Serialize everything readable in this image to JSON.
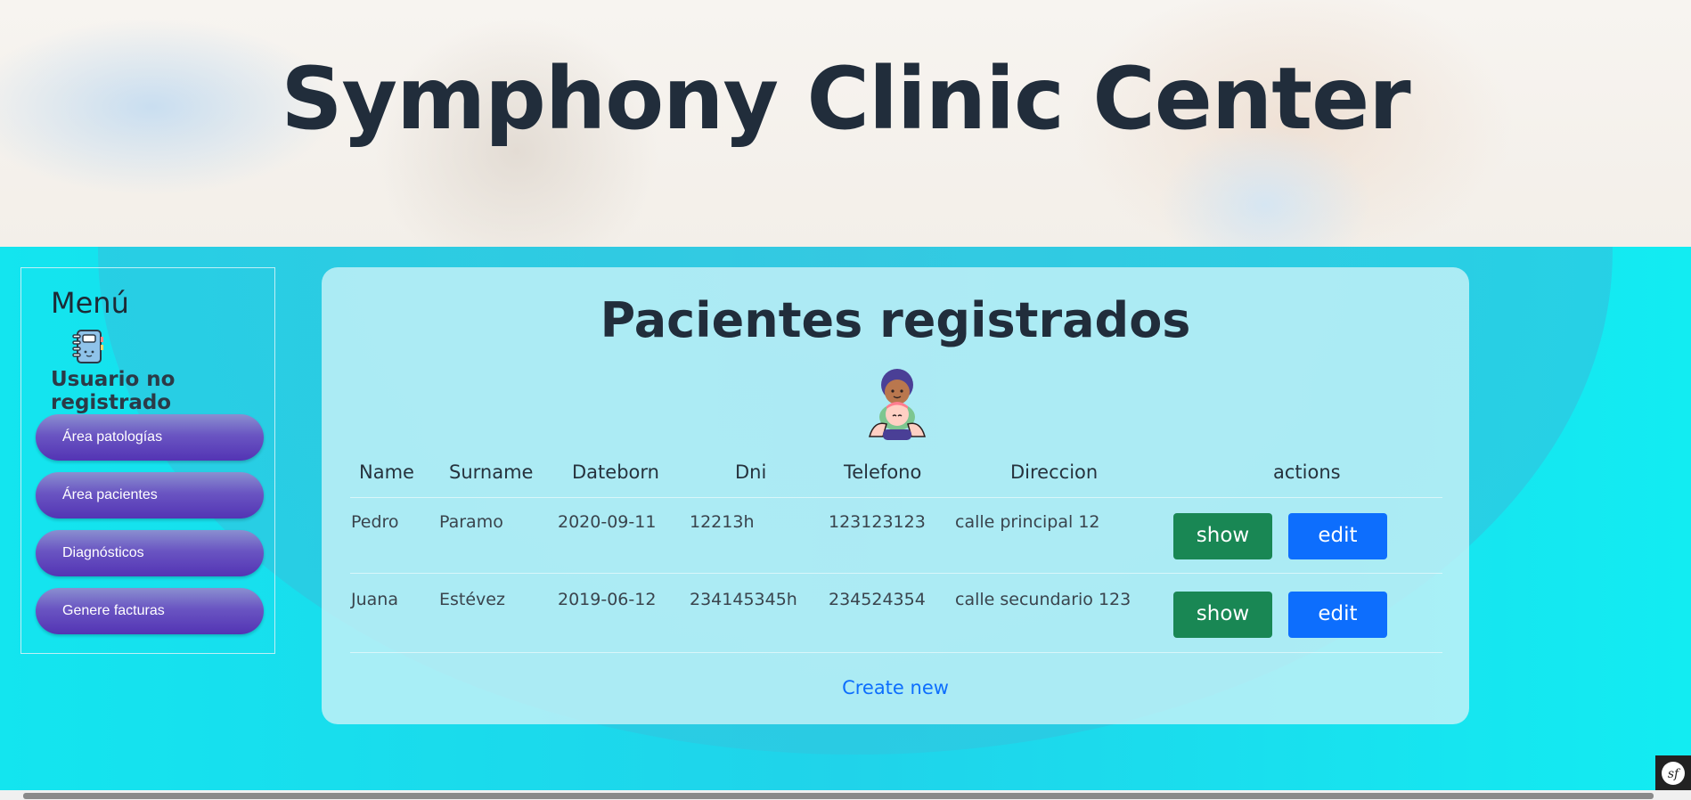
{
  "header": {
    "title": "Symphony Clinic Center"
  },
  "sidebar": {
    "title": "Menú",
    "user_status": "Usuario no registrado",
    "items": [
      {
        "label": "Área patologías"
      },
      {
        "label": "Área pacientes"
      },
      {
        "label": "Diagnósticos"
      },
      {
        "label": "Genere facturas"
      }
    ]
  },
  "main": {
    "title": "Pacientes registrados",
    "table": {
      "columns": [
        "Name",
        "Surname",
        "Dateborn",
        "Dni",
        "Telefono",
        "Direccion",
        "actions"
      ],
      "rows": [
        {
          "name": "Pedro",
          "surname": "Paramo",
          "dateborn": "2020-09-11",
          "dni": "12213h",
          "telefono": "123123123",
          "direccion": "calle principal 12"
        },
        {
          "name": "Juana",
          "surname": "Estévez",
          "dateborn": "2019-06-12",
          "dni": "234145345h",
          "telefono": "234524354",
          "direccion": "calle secundario 123"
        }
      ],
      "show_label": "show",
      "edit_label": "edit"
    },
    "create_link": "Create new"
  },
  "colors": {
    "show_button": "#198754",
    "edit_button": "#0d6efd",
    "nav_button": "#5334b4",
    "background": "#13e5ef"
  },
  "icons": {
    "sidebar": "notebook-icon",
    "panel": "patient-icon",
    "profiler": "symfony-icon"
  }
}
